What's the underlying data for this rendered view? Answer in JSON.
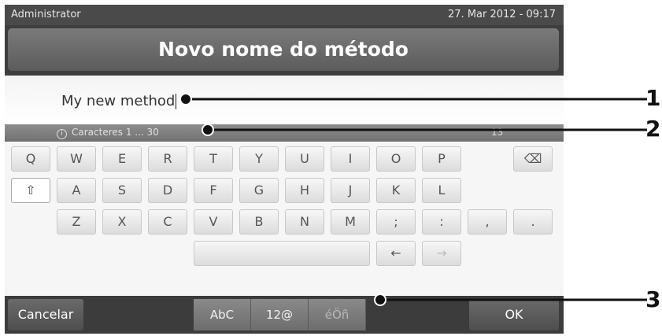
{
  "status": {
    "user": "Administrator",
    "datetime": "27. Mar 2012 - 09:17"
  },
  "title": "Novo nome do método",
  "input": {
    "value": "My new method"
  },
  "info": {
    "text": "Caracteres 1 ... 30",
    "count": "13"
  },
  "keyboard": {
    "row1": [
      "Q",
      "W",
      "E",
      "R",
      "T",
      "Y",
      "U",
      "I",
      "O",
      "P"
    ],
    "row2": [
      "A",
      "S",
      "D",
      "F",
      "G",
      "H",
      "J",
      "K",
      "L"
    ],
    "row3": [
      "Z",
      "X",
      "C",
      "V",
      "B",
      "N",
      "M",
      ";",
      ":",
      ",",
      "."
    ],
    "shift_icon": "⇧",
    "backspace_icon": "⌫",
    "arrow_left": "←",
    "arrow_right": "→"
  },
  "bottom": {
    "cancel": "Cancelar",
    "ok": "OK",
    "modes": [
      "AbC",
      "12@",
      "éÖñ"
    ]
  },
  "callouts": [
    "1",
    "2",
    "3"
  ]
}
